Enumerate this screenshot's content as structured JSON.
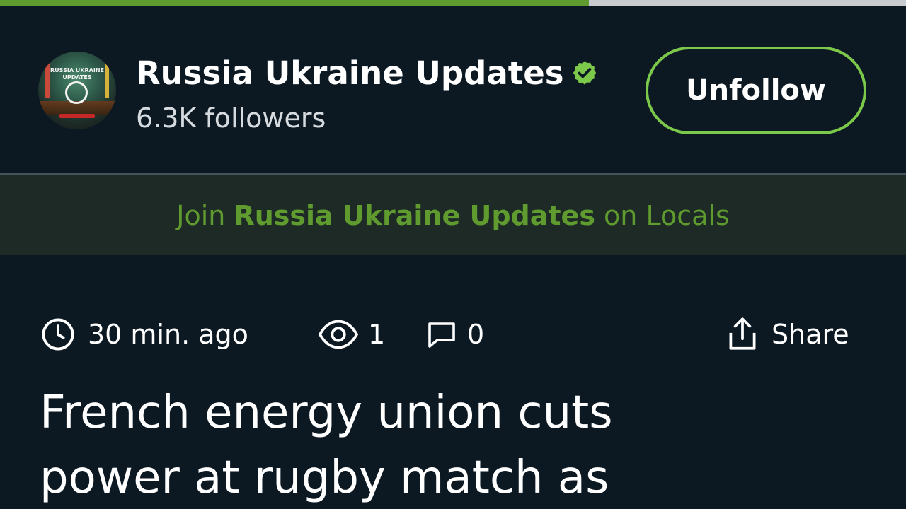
{
  "progress": {
    "fraction": 0.65,
    "fill_color": "#5f9b2e",
    "track_color": "#c9ccce"
  },
  "channel": {
    "avatar_icon": "channel-avatar",
    "avatar_text_line1": "RUSSIA UKRAINE",
    "avatar_text_line2": "UPDATES",
    "name": "Russia Ukraine Updates",
    "verified_icon": "verified-check-icon",
    "verified_color": "#7cc84a",
    "followers": "6.3K followers",
    "unfollow_label": "Unfollow",
    "accent_color": "#7cc84a"
  },
  "join_banner": {
    "prefix": "Join",
    "channel_name": "Russia Ukraine Updates",
    "suffix": "on Locals",
    "text_color": "#5f9b2e"
  },
  "post_meta": {
    "time": "30 min. ago",
    "time_icon": "clock-icon",
    "views": "1",
    "views_icon": "eye-icon",
    "comments": "0",
    "comments_icon": "comment-icon",
    "share_label": "Share",
    "share_icon": "share-icon"
  },
  "headline": {
    "line1": "French energy union cuts",
    "line2": "power at rugby match as"
  }
}
